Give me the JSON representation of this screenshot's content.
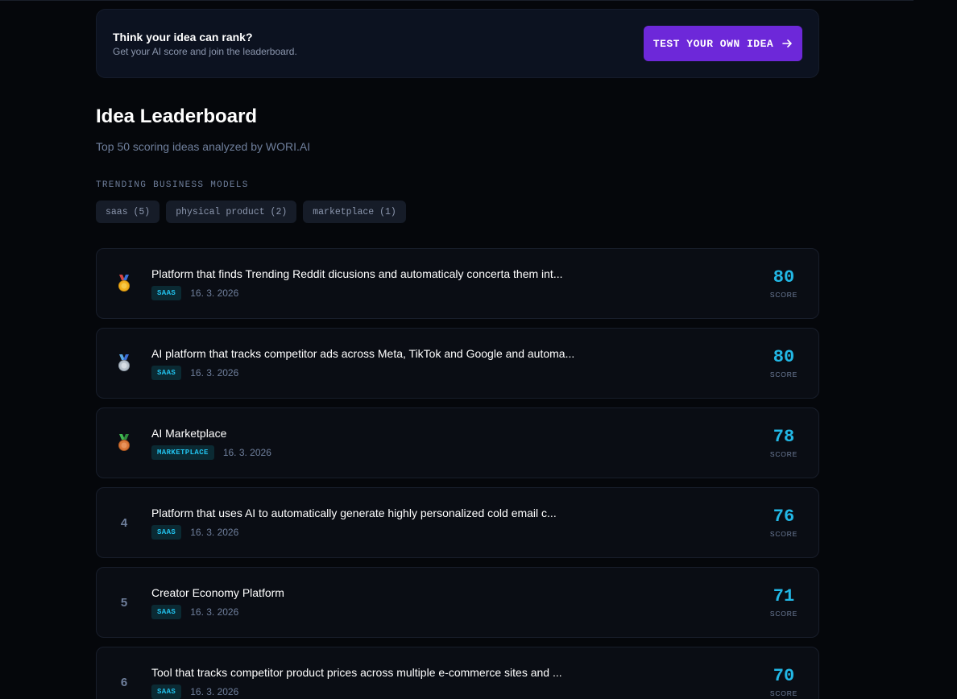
{
  "cta": {
    "title": "Think your idea can rank?",
    "subtitle": "Get your AI score and join the leaderboard.",
    "button_label": "TEST YOUR OWN IDEA",
    "button_color": "#6d28d9"
  },
  "header": {
    "title": "Idea Leaderboard",
    "subtitle": "Top 50 scoring ideas analyzed by WORI.AI"
  },
  "trending": {
    "label": "TRENDING BUSINESS MODELS",
    "chips": [
      "saas (5)",
      "physical product (2)",
      "marketplace (1)"
    ]
  },
  "score_label": "SCORE",
  "ideas": [
    {
      "rank": "1",
      "medal": "gold-medal",
      "title": "Platform that finds Trending Reddit dicusions and automaticaly concerta them int...",
      "tag": "SAAS",
      "date": "16. 3. 2026",
      "score": "80"
    },
    {
      "rank": "2",
      "medal": "silver-medal",
      "title": "AI platform that tracks competitor ads across Meta, TikTok and Google and automa...",
      "tag": "SAAS",
      "date": "16. 3. 2026",
      "score": "80"
    },
    {
      "rank": "3",
      "medal": "bronze-medal",
      "title": "AI Marketplace",
      "tag": "MARKETPLACE",
      "date": "16. 3. 2026",
      "score": "78"
    },
    {
      "rank": "4",
      "medal": "",
      "title": "Platform that uses AI to automatically generate highly personalized cold email c...",
      "tag": "SAAS",
      "date": "16. 3. 2026",
      "score": "76"
    },
    {
      "rank": "5",
      "medal": "",
      "title": "Creator Economy Platform",
      "tag": "SAAS",
      "date": "16. 3. 2026",
      "score": "71"
    },
    {
      "rank": "6",
      "medal": "",
      "title": "Tool that tracks competitor product prices across multiple e-commerce sites and ...",
      "tag": "SAAS",
      "date": "16. 3. 2026",
      "score": "70"
    }
  ],
  "colors": {
    "accent": "#22b8e6",
    "background": "#05070b",
    "card": "#0a0d14"
  }
}
